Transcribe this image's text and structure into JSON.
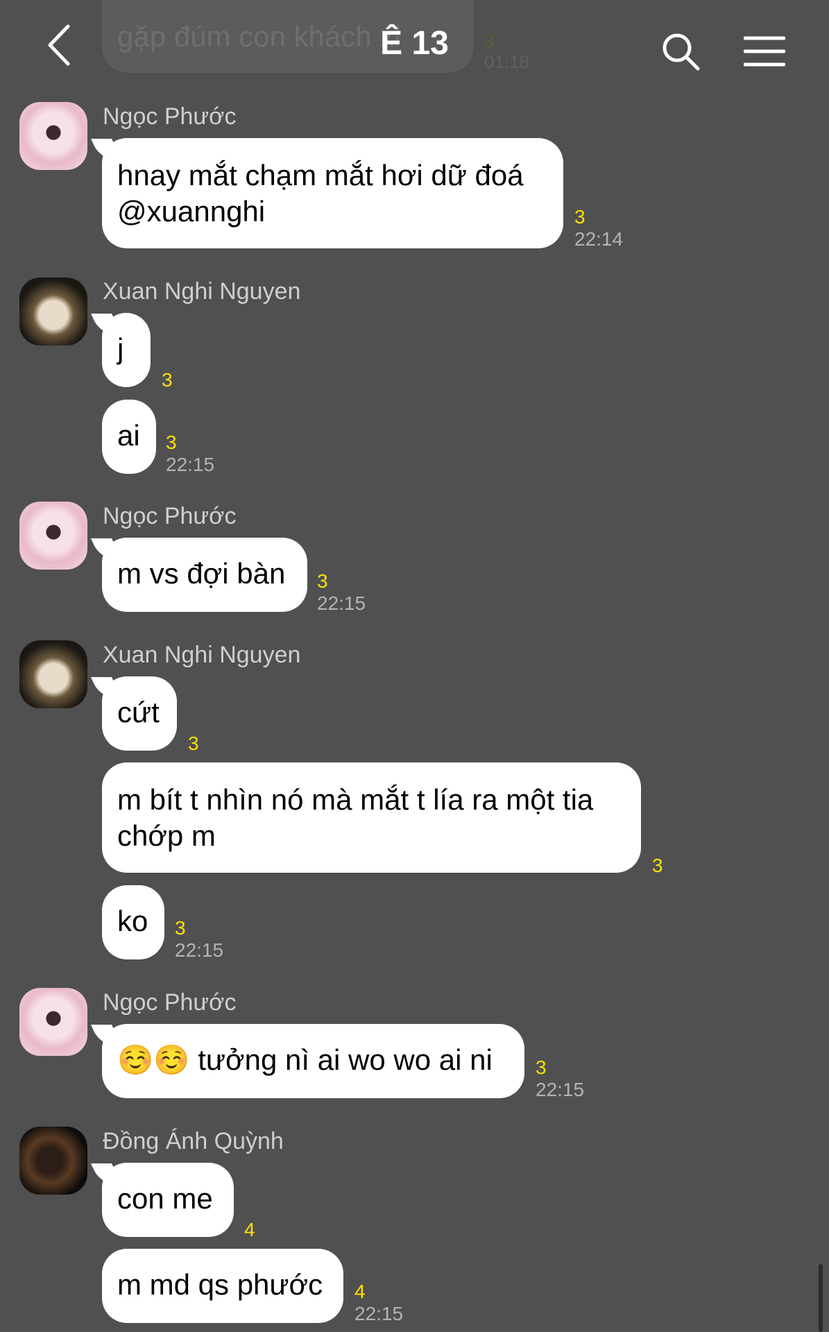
{
  "header": {
    "title": "Ê 13",
    "previous_message_preview": "gặp đúm con khách xl",
    "previous_message_count": "3",
    "previous_message_time": "01:18"
  },
  "messages": [
    {
      "sender": "Ngọc Phước",
      "avatar": "avatar-ngoc-phuoc",
      "bubbles": [
        {
          "lines": [
            "hnay mắt chạm mắt hơi dữ đoá",
            "@xuannghi"
          ],
          "count": "3",
          "time": "22:14"
        }
      ]
    },
    {
      "sender": "Xuan Nghi Nguyen",
      "avatar": "avatar-xuan-nghi",
      "bubbles": [
        {
          "lines": [
            "j"
          ],
          "count": "3",
          "time": ""
        },
        {
          "lines": [
            "ai"
          ],
          "count": "3",
          "time": "22:15"
        }
      ]
    },
    {
      "sender": "Ngọc Phước",
      "avatar": "avatar-ngoc-phuoc",
      "bubbles": [
        {
          "lines": [
            "m vs đợi bàn"
          ],
          "count": "3",
          "time": "22:15"
        }
      ]
    },
    {
      "sender": "Xuan Nghi Nguyen",
      "avatar": "avatar-xuan-nghi",
      "bubbles": [
        {
          "lines": [
            "cứt"
          ],
          "count": "3",
          "time": ""
        },
        {
          "lines": [
            "m bít t nhìn nó mà mắt t lía ra một tia",
            "chớp m"
          ],
          "count": "3",
          "time": ""
        },
        {
          "lines": [
            "ko"
          ],
          "count": "3",
          "time": "22:15"
        }
      ]
    },
    {
      "sender": "Ngọc Phước",
      "avatar": "avatar-ngoc-phuoc",
      "bubbles": [
        {
          "lines": [
            "☺️☺️ tưởng nì ai wo wo ai ni"
          ],
          "count": "3",
          "time": "22:15"
        }
      ]
    },
    {
      "sender": "Đồng Ánh Quỳnh",
      "avatar": "avatar-dong-anh-quynh",
      "bubbles": [
        {
          "lines": [
            "con me"
          ],
          "count": "4",
          "time": ""
        },
        {
          "lines": [
            "m md qs phước"
          ],
          "count": "4",
          "time": "22:15"
        }
      ]
    }
  ]
}
